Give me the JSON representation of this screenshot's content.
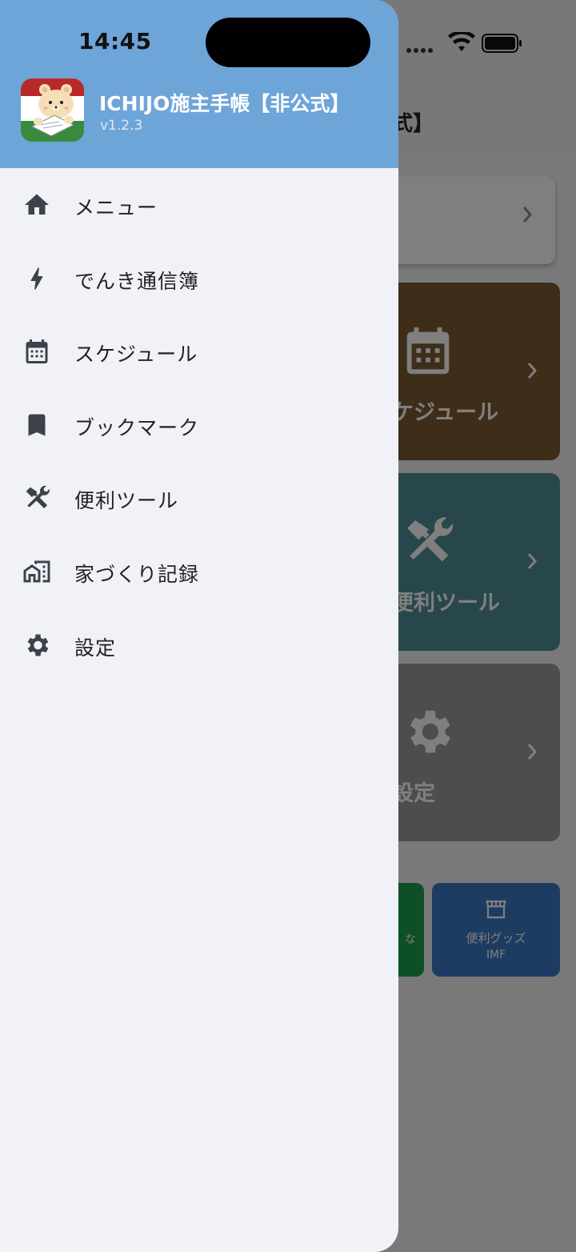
{
  "status_bar": {
    "time": "14:45"
  },
  "drawer": {
    "app_title": "ICHIJO施主手帳【非公式】",
    "app_version": "v1.2.3",
    "items": [
      {
        "label": "メニュー",
        "icon": "home-icon"
      },
      {
        "label": "でんき通信簿",
        "icon": "lightning-icon"
      },
      {
        "label": "スケジュール",
        "icon": "calendar-icon"
      },
      {
        "label": "ブックマーク",
        "icon": "bookmark-icon"
      },
      {
        "label": "便利ツール",
        "icon": "tools-icon"
      },
      {
        "label": "家づくり記録",
        "icon": "house-record-icon"
      },
      {
        "label": "設定",
        "icon": "gear-icon"
      }
    ]
  },
  "background": {
    "title_fragment": "式】",
    "tiles": [
      {
        "label": "ケジュール",
        "color": "#7a5a33"
      },
      {
        "label": "便利ツール",
        "color": "#4f8f99"
      },
      {
        "label": "設定",
        "color": "#9a9a9a"
      }
    ],
    "chips": {
      "green_fragment": "な",
      "blue_line1": "便利グッズ",
      "blue_line2": "IMF"
    }
  },
  "colors": {
    "drawer_header": "#6ea5d8",
    "drawer_bg": "#f0f2f8",
    "icon": "#3d4148"
  }
}
